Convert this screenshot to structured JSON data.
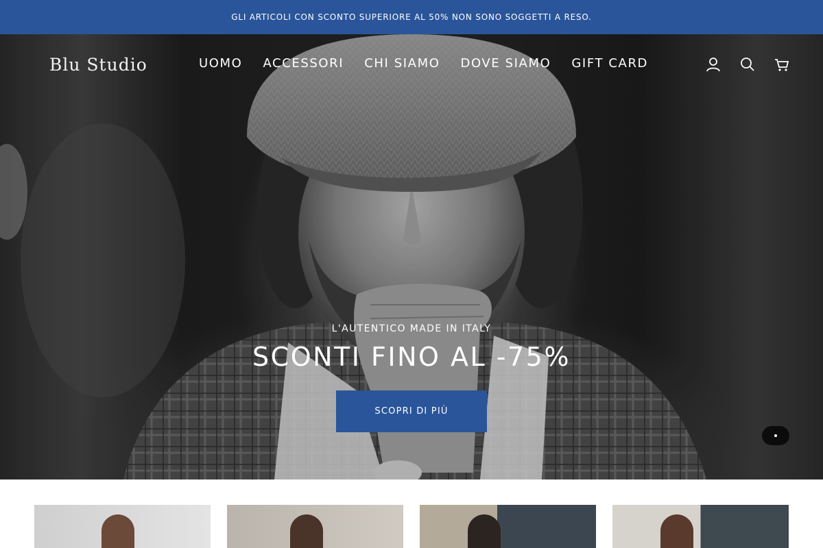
{
  "announcement": {
    "text": "GLI ARTICOLI CON SCONTO SUPERIORE AL 50% NON SONO SOGGETTI A RESO."
  },
  "header": {
    "logo": "Blu Studio",
    "nav": [
      {
        "label": "UOMO"
      },
      {
        "label": "ACCESSORI"
      },
      {
        "label": "CHI SIAMO"
      },
      {
        "label": "DOVE SIAMO"
      },
      {
        "label": "GIFT CARD"
      }
    ],
    "icons": [
      "account-icon",
      "search-icon",
      "cart-icon"
    ]
  },
  "hero": {
    "kicker": "L'AUTENTICO MADE IN ITALY",
    "headline": "SCONTI FINO AL -75%",
    "cta": "SCOPRI DI PIÙ"
  },
  "colors": {
    "brand": "#2a559a",
    "text_on_dark": "#ffffff"
  },
  "products": [
    {
      "name": "product-1"
    },
    {
      "name": "product-2"
    },
    {
      "name": "product-3"
    },
    {
      "name": "product-4"
    }
  ]
}
